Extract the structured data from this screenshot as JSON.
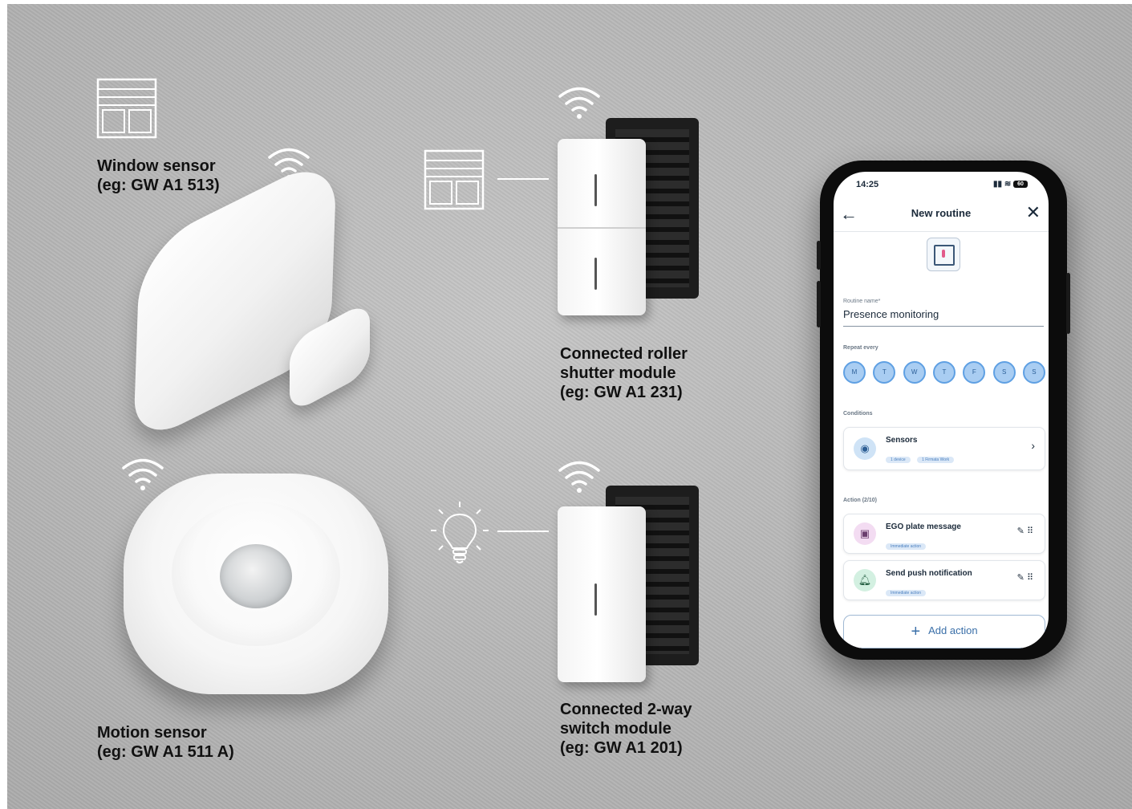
{
  "labels": {
    "window_sensor": [
      "Window sensor",
      "(eg: GW A1 513)"
    ],
    "motion_sensor": [
      "Motion sensor",
      "(eg: GW A1 511 A)"
    ],
    "roller_module": [
      "Connected roller",
      "shutter module",
      "(eg: GW A1 231)"
    ],
    "switch_module": [
      "Connected 2-way",
      "switch module",
      "(eg: GW A1 201)"
    ]
  },
  "phone": {
    "status_time": "14:25",
    "battery": "60",
    "header": {
      "back": "←",
      "title": "New routine",
      "close": "✕"
    },
    "routine_name_label": "Routine name*",
    "routine_name_value": "Presence monitoring",
    "repeat_label": "Repeat every",
    "days": [
      "M",
      "T",
      "W",
      "T",
      "F",
      "S",
      "S"
    ],
    "conditions_label": "Conditions",
    "condition": {
      "title": "Sensors",
      "chips": [
        "1 device",
        "1 Firmata Work"
      ],
      "chevron": "›"
    },
    "actions_label": "Action (2/10)",
    "actions": [
      {
        "title": "EGO plate message",
        "chip": "Immediate action"
      },
      {
        "title": "Send push notification",
        "chip": "Immediate action"
      }
    ],
    "add_action": {
      "plus": "+",
      "label": "Add action"
    }
  },
  "icons": {
    "wifi": "wifi-icon",
    "window": "window-blind-icon",
    "bulb": "lightbulb-icon",
    "sensor": "sensor-icon",
    "message": "message-icon",
    "bell": "bell-icon",
    "edit": "pencil-icon",
    "drag": "drag-handle-icon"
  },
  "colors": {
    "background": "#b9b9b9",
    "label_text": "#111111",
    "day_fill": "#a9cdf2",
    "accent": "#3a6fa8",
    "condition_icon_bg": "#cfe3f6",
    "message_icon_bg": "#f3dcf2",
    "bell_icon_bg": "#d3f0e1"
  }
}
